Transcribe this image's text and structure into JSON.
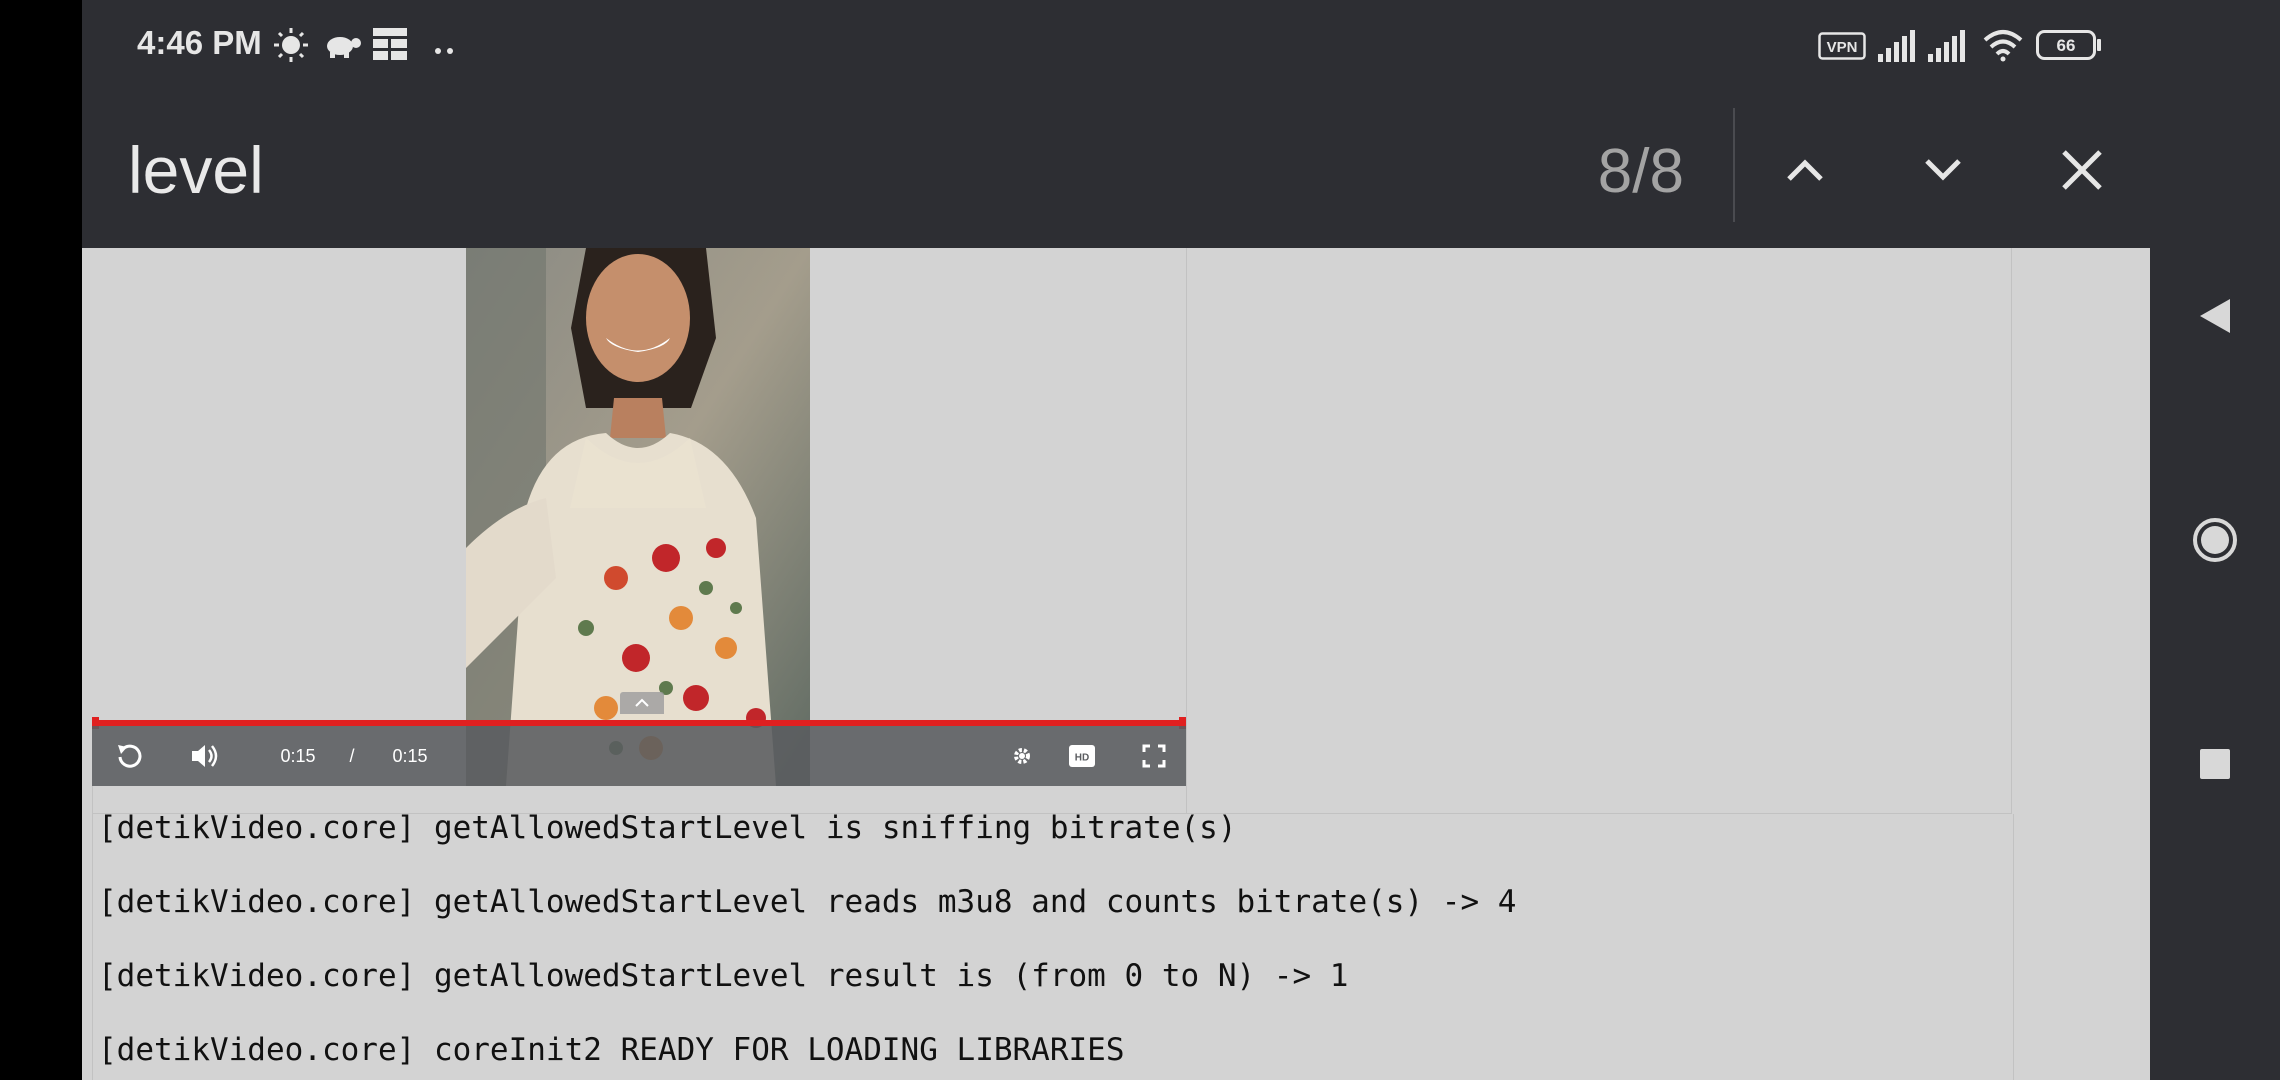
{
  "status_bar": {
    "time": "4:46 PM",
    "vpn_label": "VPN",
    "battery_level": "66"
  },
  "find_bar": {
    "query": "level",
    "match_count": "8/8"
  },
  "video": {
    "current_time": "0:15",
    "time_separator": "/",
    "duration": "0:15",
    "progress_percent": 100,
    "accent_color": "#e02020"
  },
  "log": {
    "lines": [
      "[detikVideo.core] getAllowedStartLevel is sniffing bitrate(s)",
      "[detikVideo.core] getAllowedStartLevel reads m3u8 and counts bitrate(s) -> 4",
      "[detikVideo.core] getAllowedStartLevel result is (from 0 to N) -> 1",
      "[detikVideo.core] coreInit2 READY FOR LOADING LIBRARIES"
    ]
  }
}
